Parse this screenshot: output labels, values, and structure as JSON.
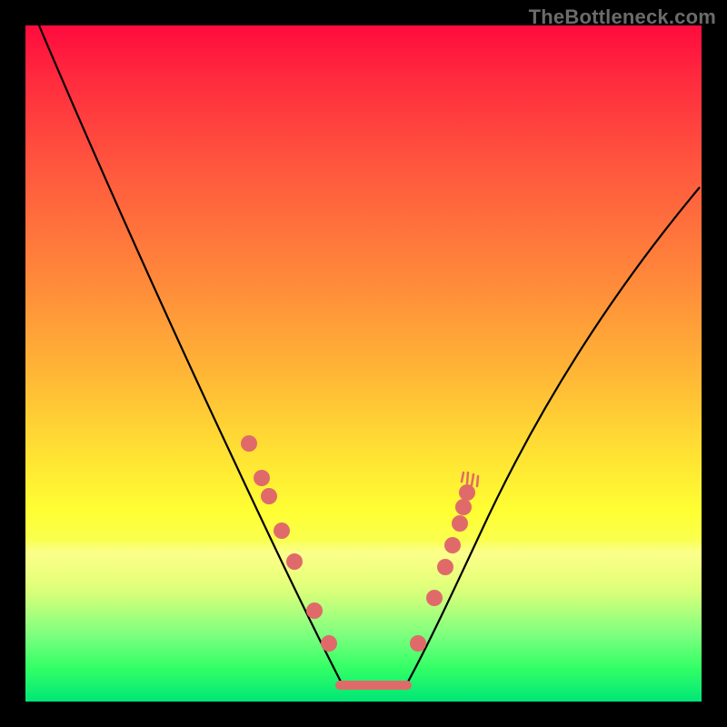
{
  "watermark": "TheBottleneck.com",
  "chart_data": {
    "type": "line",
    "title": "",
    "xlabel": "",
    "ylabel": "",
    "xlim": [
      0,
      100
    ],
    "ylim": [
      0,
      100
    ],
    "series": [
      {
        "name": "bottleneck-curve",
        "x": [
          2,
          10,
          20,
          28,
          33,
          37,
          40,
          43,
          46,
          50,
          54,
          57,
          60,
          63,
          66,
          72,
          80,
          90,
          99
        ],
        "y": [
          100,
          84,
          64,
          48,
          38,
          30,
          23,
          15,
          8,
          2,
          2,
          8,
          15,
          23,
          31,
          43,
          56,
          68,
          76
        ]
      }
    ],
    "markers": {
      "left_cluster": [
        {
          "x": 33,
          "y": 38
        },
        {
          "x": 35,
          "y": 33
        },
        {
          "x": 36,
          "y": 30
        },
        {
          "x": 38,
          "y": 25
        },
        {
          "x": 40,
          "y": 21
        },
        {
          "x": 43,
          "y": 13
        },
        {
          "x": 45,
          "y": 9
        }
      ],
      "plateau": {
        "x_start": 46,
        "x_end": 56,
        "y": 2
      },
      "right_cluster": [
        {
          "x": 57,
          "y": 8
        },
        {
          "x": 60,
          "y": 15
        },
        {
          "x": 62,
          "y": 21
        },
        {
          "x": 63,
          "y": 24
        },
        {
          "x": 64,
          "y": 27
        },
        {
          "x": 64.5,
          "y": 29
        },
        {
          "x": 65,
          "y": 31
        }
      ]
    },
    "background_gradient": {
      "top": "#ff0b3e",
      "mid_upper": "#ff8a3a",
      "mid": "#ffe433",
      "mid_lower": "#d6ff7a",
      "bottom": "#00e676"
    }
  }
}
